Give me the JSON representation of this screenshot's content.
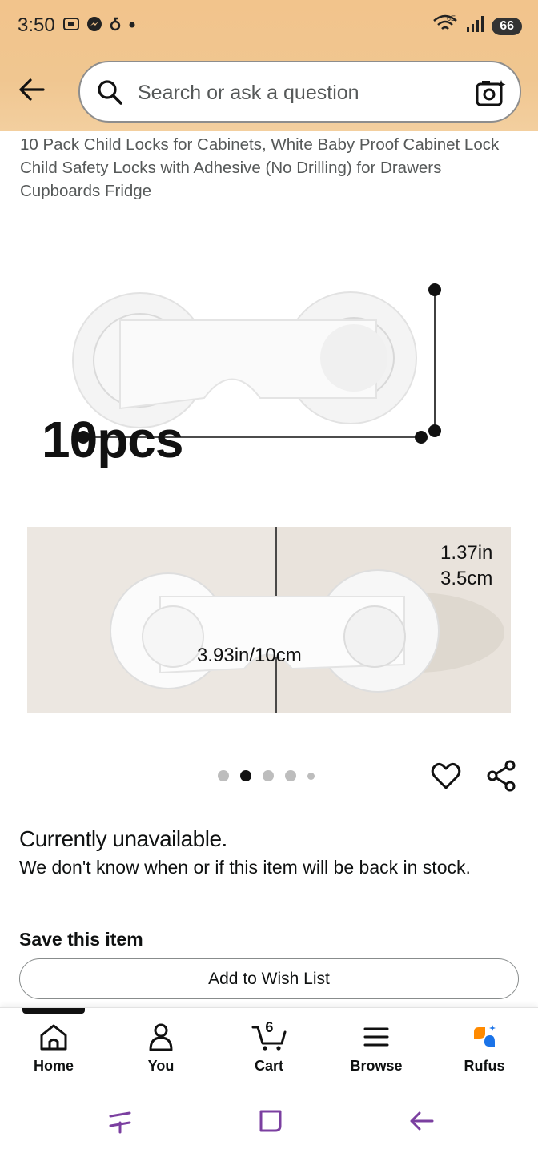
{
  "status_bar": {
    "time": "3:50",
    "network": "6E",
    "battery": "66"
  },
  "search": {
    "placeholder": "Search or ask a question"
  },
  "product": {
    "title": "10 Pack Child Locks for Cabinets, White Baby Proof Cabinet Lock Child Safety Locks with Adhesive (No Drilling) for Drawers Cupboards Fridge",
    "image_text": {
      "count": "10pcs",
      "width": "3.93in/10cm",
      "height_in": "1.37in",
      "height_cm": "3.5cm"
    },
    "carousel": {
      "total": 5,
      "active_index": 1
    }
  },
  "availability": {
    "heading": "Currently unavailable.",
    "message": "We don't know when or if this item will be back in stock."
  },
  "save": {
    "heading": "Save this item",
    "button": "Add to Wish List"
  },
  "bottom_nav": {
    "items": [
      {
        "label": "Home",
        "icon": "home-icon"
      },
      {
        "label": "You",
        "icon": "person-icon"
      },
      {
        "label": "Cart",
        "icon": "cart-icon",
        "badge": "6"
      },
      {
        "label": "Browse",
        "icon": "menu-icon"
      },
      {
        "label": "Rufus",
        "icon": "rufus-icon"
      }
    ],
    "active": "Home"
  },
  "colors": {
    "header_bg": "#f2c48c",
    "rufus_orange": "#ff8a00",
    "rufus_blue": "#1a73e8",
    "system_nav": "#7b3fa0"
  }
}
